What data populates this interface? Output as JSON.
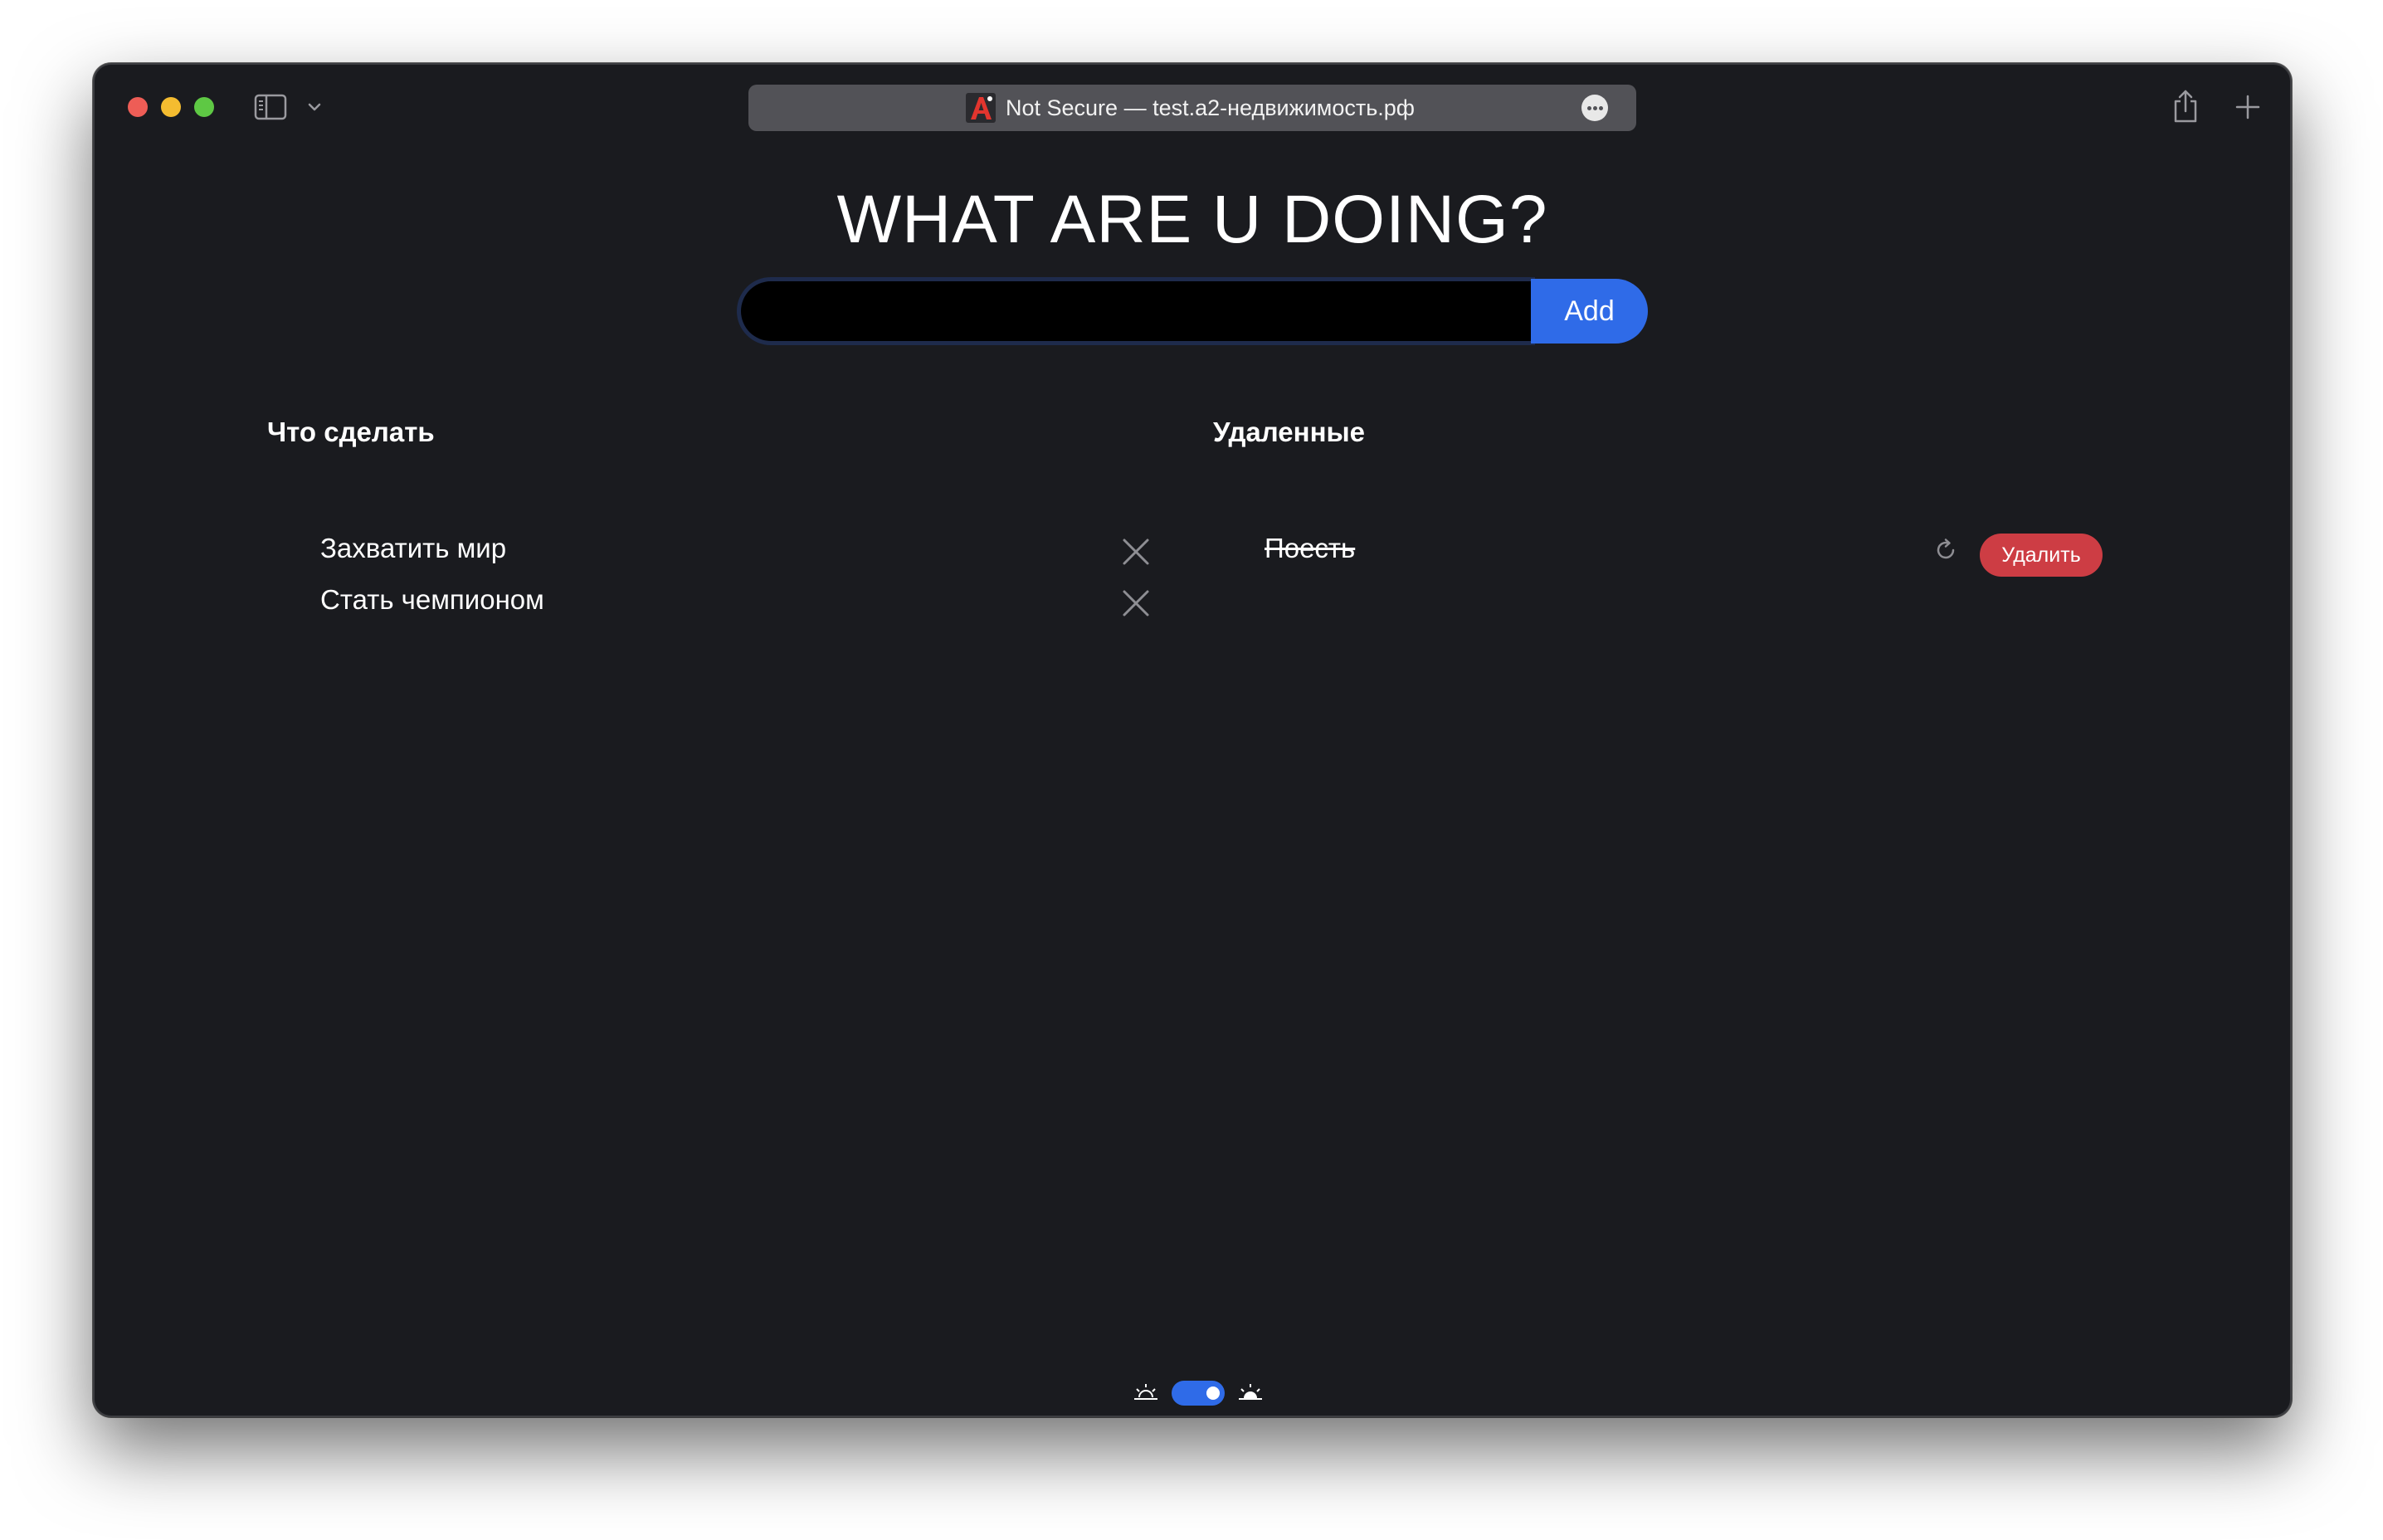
{
  "browser": {
    "address": "Not Secure — test.a2-недвижимость.рф"
  },
  "app": {
    "title": "WHAT ARE U DOING?",
    "input": {
      "value": "",
      "placeholder": ""
    },
    "add_label": "Add",
    "columns": {
      "todo": {
        "heading": "Что сделать",
        "items": [
          {
            "label": "Захватить мир"
          },
          {
            "label": "Стать чемпионом"
          }
        ]
      },
      "deleted": {
        "heading": "Удаленные",
        "items": [
          {
            "label": "Поесть",
            "delete_label": "Удалить"
          }
        ]
      }
    },
    "theme": {
      "mode": "dark",
      "toggle_on": true
    }
  },
  "colors": {
    "background": "#1a1b1f",
    "accent": "#2f6be8",
    "danger": "#cd3d44",
    "text": "#ffffff"
  },
  "icons": [
    "sidebar-icon",
    "chevron-down-icon",
    "site-logo-icon",
    "more-icon",
    "share-icon",
    "plus-icon",
    "close-icon",
    "restore-icon",
    "sunset-icon",
    "sunrise-icon"
  ]
}
